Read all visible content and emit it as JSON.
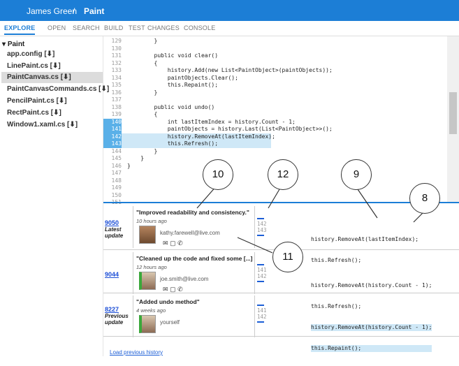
{
  "titlebar": {
    "user": "James Green",
    "separator": "/",
    "project": "Paint"
  },
  "menu": [
    "EXPLORE",
    "OPEN",
    "SEARCH",
    "BUILD",
    "TEST",
    "CHANGES",
    "CONSOLE"
  ],
  "sidebar": {
    "root": "Paint",
    "files": [
      "app.config [⬇]",
      "LinePaint.cs [⬇]",
      "PaintCanvas.cs [⬇]",
      "PaintCanvasCommands.cs [⬇]",
      "PencilPaint.cs [⬇]",
      "RectPaint.cs [⬇]",
      "Window1.xaml.cs [⬇]"
    ]
  },
  "code": [
    {
      "ln": "129",
      "src": "        }"
    },
    {
      "ln": "130",
      "src": ""
    },
    {
      "ln": "131",
      "src": "        public void clear()"
    },
    {
      "ln": "132",
      "src": "        {"
    },
    {
      "ln": "133",
      "src": "            history.Add(new List<PaintObject>(paintObjects));"
    },
    {
      "ln": "134",
      "src": "            paintObjects.Clear();"
    },
    {
      "ln": "135",
      "src": "            this.Repaint();"
    },
    {
      "ln": "136",
      "src": "        }"
    },
    {
      "ln": "137",
      "src": ""
    },
    {
      "ln": "138",
      "src": "        public void undo()"
    },
    {
      "ln": "139",
      "src": "        {"
    },
    {
      "ln": "140",
      "src": "            int lastItemIndex = history.Count - 1;"
    },
    {
      "ln": "141",
      "src": "            paintObjects = history.Last(List<PaintObject>>();"
    },
    {
      "ln": "142",
      "src": "            history.RemoveAt(lastItemIndex);"
    },
    {
      "ln": "143",
      "src": "            this.Refresh();"
    },
    {
      "ln": "144",
      "src": "        }"
    },
    {
      "ln": "145",
      "src": "    }"
    },
    {
      "ln": "146",
      "src": "}"
    },
    {
      "ln": "147",
      "src": ""
    },
    {
      "ln": "148",
      "src": ""
    },
    {
      "ln": "149",
      "src": ""
    },
    {
      "ln": "150",
      "src": ""
    },
    {
      "ln": "151",
      "src": ""
    }
  ],
  "history": [
    {
      "id": "9050",
      "sub1": "Latest",
      "sub2": "update",
      "message": "\"Improved readability and consistency.\"",
      "ago": "10 hours ago",
      "email": "kathy.farewell@live.com",
      "lines": [
        "142",
        "143"
      ],
      "diff1": "history.RemoveAt(lastItemIndex);",
      "diff2": "this.Refresh();"
    },
    {
      "id": "9044",
      "sub1": "",
      "sub2": "",
      "message": "\"Cleaned up the code and fixed some [...]",
      "ago": "12 hours ago",
      "email": "joe.smith@live.com",
      "lines": [
        "141",
        "142"
      ],
      "diff1": "history.RemoveAt(history.Count - 1);",
      "diff2": "this.Refresh();"
    },
    {
      "id": "8227",
      "sub1": "Previous",
      "sub2": "update",
      "message": "\"Added undo method\"",
      "ago": "4 weeks ago",
      "email": "yourself",
      "lines": [
        "141",
        "142"
      ],
      "diff1": "history.RemoveAt(history.Count - 1);",
      "diff2": "this.Repaint();"
    }
  ],
  "load_link": "Load previous history",
  "callouts": [
    "10",
    "12",
    "9",
    "8",
    "11"
  ],
  "colors": {
    "accent": "#1c7ed6",
    "highlight": "#5ab0e8",
    "highlight_light": "#cfe8f7"
  }
}
